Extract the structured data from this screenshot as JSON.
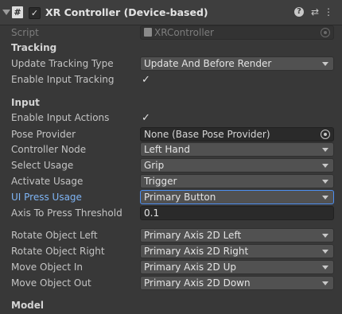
{
  "header": {
    "script_icon_glyph": "#",
    "enabled_check": "✓",
    "title": "XR Controller (Device-based)",
    "help_glyph": "?",
    "presets_glyph": "⇄",
    "menu_glyph": "⋮"
  },
  "script_row": {
    "label": "Script",
    "value": "XRController"
  },
  "tracking": {
    "section_title": "Tracking",
    "update_tracking_type": {
      "label": "Update Tracking Type",
      "value": "Update And Before Render"
    },
    "enable_input_tracking": {
      "label": "Enable Input Tracking",
      "checked": "✓"
    }
  },
  "input": {
    "section_title": "Input",
    "enable_input_actions": {
      "label": "Enable Input Actions",
      "checked": "✓"
    },
    "pose_provider": {
      "label": "Pose Provider",
      "value": "None (Base Pose Provider)"
    },
    "controller_node": {
      "label": "Controller Node",
      "value": "Left Hand"
    },
    "select_usage": {
      "label": "Select Usage",
      "value": "Grip"
    },
    "activate_usage": {
      "label": "Activate Usage",
      "value": "Trigger"
    },
    "ui_press_usage": {
      "label": "UI Press Usage",
      "value": "Primary Button"
    },
    "axis_to_press_threshold": {
      "label": "Axis To Press Threshold",
      "value": "0.1"
    },
    "rotate_object_left": {
      "label": "Rotate Object Left",
      "value": "Primary Axis 2D Left"
    },
    "rotate_object_right": {
      "label": "Rotate Object Right",
      "value": "Primary Axis 2D Right"
    },
    "move_object_in": {
      "label": "Move Object In",
      "value": "Primary Axis 2D Up"
    },
    "move_object_out": {
      "label": "Move Object Out",
      "value": "Primary Axis 2D Down"
    }
  },
  "model": {
    "section_title": "Model"
  },
  "colors": {
    "background": "#383838",
    "header_bg": "#3e3e3e",
    "dropdown_bg": "#515151",
    "active_border": "#4d8ff2",
    "highlight_label": "#7fb5f5"
  }
}
